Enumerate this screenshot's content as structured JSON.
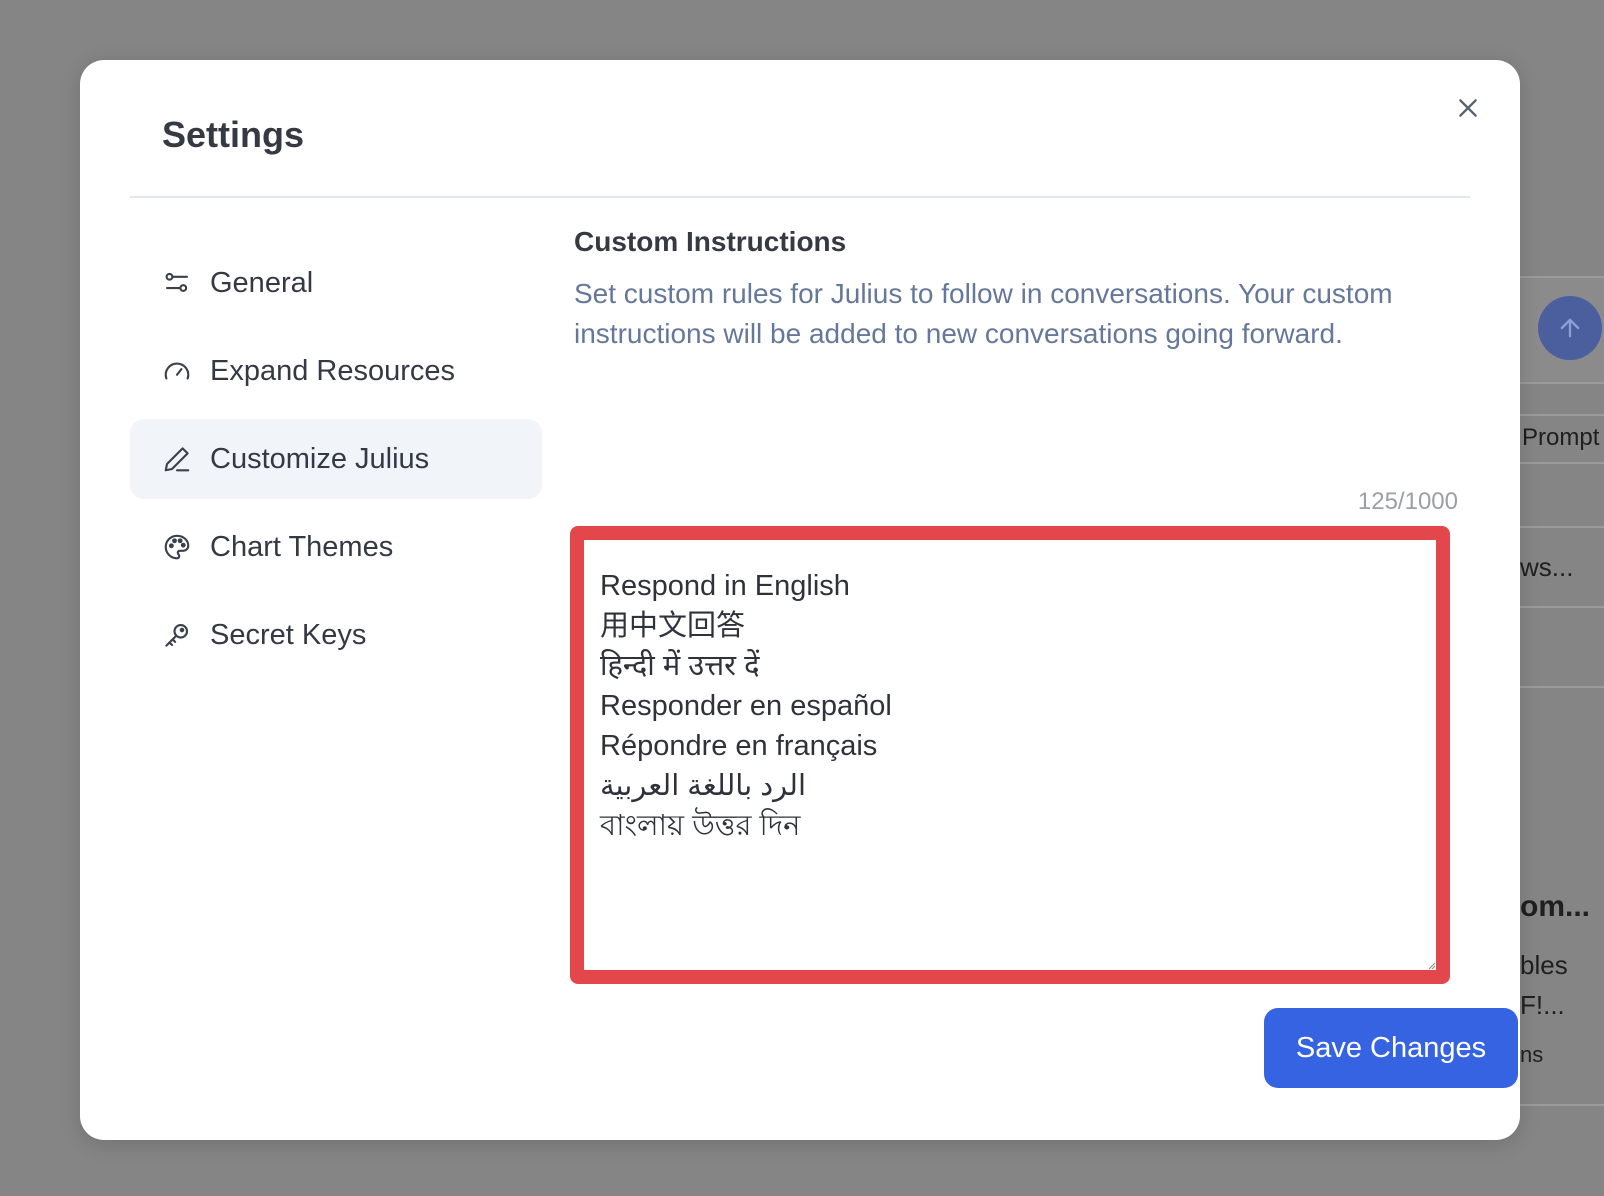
{
  "modal": {
    "title": "Settings",
    "close_icon": "close-icon"
  },
  "sidebar": {
    "items": [
      {
        "label": "General",
        "icon": "sliders-icon",
        "active": false
      },
      {
        "label": "Expand Resources",
        "icon": "gauge-icon",
        "active": false
      },
      {
        "label": "Customize Julius",
        "icon": "pencil-icon",
        "active": true
      },
      {
        "label": "Chart Themes",
        "icon": "palette-icon",
        "active": false
      },
      {
        "label": "Secret Keys",
        "icon": "key-icon",
        "active": false
      }
    ]
  },
  "custom_instructions": {
    "title": "Custom Instructions",
    "description": "Set custom rules for Julius to follow in conversations. Your custom instructions will be added to new conversations going forward.",
    "char_count": "125/1000",
    "lines": [
      "Respond in English",
      "用中文回答",
      "हिन्दी में उत्तर दें",
      "Responder en español",
      "Répondre en français",
      "الرد باللغة العربية",
      "বাংলায় উত্তর দিন"
    ],
    "save_label": "Save Changes"
  },
  "background": {
    "send_icon": "arrow-up-icon",
    "texts": [
      "Prompt",
      "ws...",
      "om...",
      "bles",
      "F!...",
      "ns"
    ]
  },
  "colors": {
    "overlay": "#858585",
    "accent": "#3563e2",
    "highlight": "#e3474b",
    "description_text": "#66789a"
  }
}
